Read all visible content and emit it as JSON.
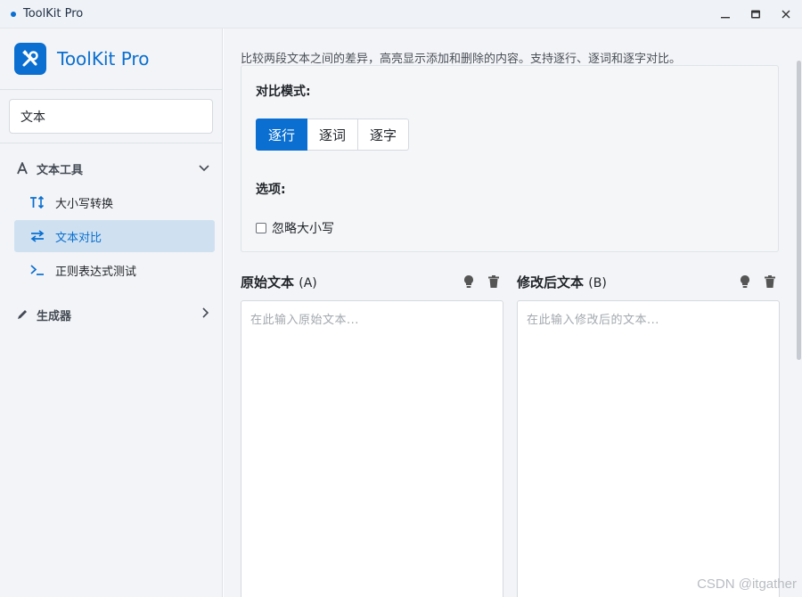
{
  "window": {
    "title": "ToolKit Pro"
  },
  "brand": {
    "name": "ToolKit Pro"
  },
  "search": {
    "value": "文本"
  },
  "sidebar": {
    "groups": [
      {
        "label": "文本工具",
        "expanded": true,
        "items": [
          {
            "label": "大小写转换",
            "icon": "text-case-icon"
          },
          {
            "label": "文本对比",
            "icon": "swap-icon",
            "active": true
          },
          {
            "label": "正则表达式测试",
            "icon": "terminal-icon"
          }
        ]
      },
      {
        "label": "生成器",
        "expanded": false
      }
    ]
  },
  "main": {
    "description": "比较两段文本之间的差异，高亮显示添加和删除的内容。支持逐行、逐词和逐字对比。",
    "mode_label": "对比模式:",
    "modes": [
      "逐行",
      "逐词",
      "逐字"
    ],
    "active_mode": "逐行",
    "options_label": "选项:",
    "ignore_case_label": "忽略大小写",
    "ignore_case_checked": false,
    "left": {
      "title": "原始文本",
      "suffix": "(A)",
      "placeholder": "在此输入原始文本...",
      "value": ""
    },
    "right": {
      "title": "修改后文本",
      "suffix": "(B)",
      "placeholder": "在此输入修改后的文本...",
      "value": ""
    }
  },
  "watermark": "CSDN @itgather",
  "colors": {
    "accent": "#0a6fd0",
    "active_bg": "#cfe1f1"
  }
}
